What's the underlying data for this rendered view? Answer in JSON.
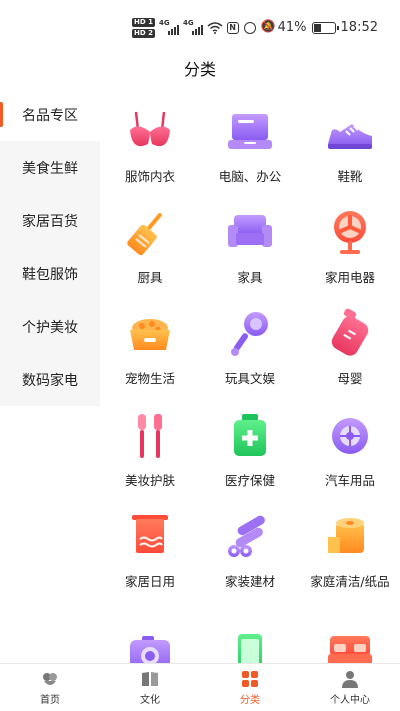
{
  "status_bar": {
    "hd1": "HD 1",
    "hd2": "HD 2",
    "net1": "4G",
    "net2": "4G",
    "battery_percent": "41%",
    "battery_level": 0.41,
    "time": "18:52"
  },
  "header": {
    "title": "分类"
  },
  "sidebar": {
    "items": [
      {
        "label": "名品专区",
        "active": true
      },
      {
        "label": "美食生鲜"
      },
      {
        "label": "家居百货"
      },
      {
        "label": "鞋包服饰"
      },
      {
        "label": "个护美妆"
      },
      {
        "label": "数码家电"
      }
    ]
  },
  "categories": [
    {
      "label": "服饰内衣",
      "icon": "bra-icon"
    },
    {
      "label": "电脑、办公",
      "icon": "laptop-icon"
    },
    {
      "label": "鞋靴",
      "icon": "sneaker-icon"
    },
    {
      "label": "厨具",
      "icon": "spatula-icon"
    },
    {
      "label": "家具",
      "icon": "sofa-icon"
    },
    {
      "label": "家用电器",
      "icon": "fan-icon"
    },
    {
      "label": "宠物生活",
      "icon": "pet-bowl-icon"
    },
    {
      "label": "玩具文娱",
      "icon": "rattle-icon"
    },
    {
      "label": "母婴",
      "icon": "baby-bottle-icon"
    },
    {
      "label": "美妆护肤",
      "icon": "makeup-brush-icon"
    },
    {
      "label": "医疗保健",
      "icon": "medicine-box-icon"
    },
    {
      "label": "汽车用品",
      "icon": "tire-icon"
    },
    {
      "label": "家居日用",
      "icon": "towel-icon"
    },
    {
      "label": "家装建材",
      "icon": "pipes-icon"
    },
    {
      "label": "家庭清洁/纸品",
      "icon": "tissue-roll-icon"
    },
    {
      "label": "",
      "icon": "camera-icon"
    },
    {
      "label": "",
      "icon": "phone-icon"
    },
    {
      "label": "",
      "icon": "bed-icon"
    }
  ],
  "tab_bar": {
    "tabs": [
      {
        "label": "首页",
        "icon": "home-icon"
      },
      {
        "label": "文化",
        "icon": "book-icon"
      },
      {
        "label": "分类",
        "icon": "category-grid-icon",
        "active": true
      },
      {
        "label": "个人中心",
        "icon": "person-icon"
      }
    ]
  },
  "colors": {
    "accent": "#f15a24",
    "sidebar_bg": "#f6f6f6"
  }
}
